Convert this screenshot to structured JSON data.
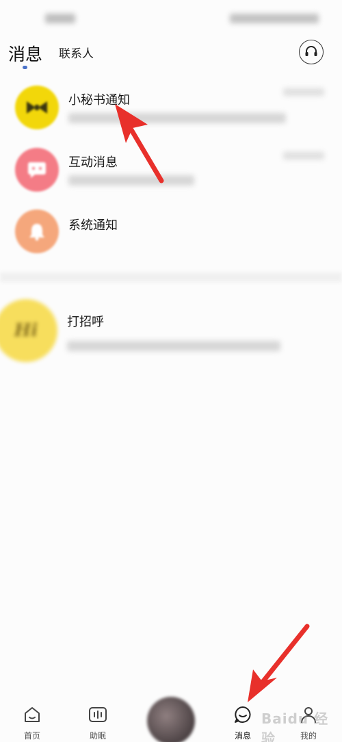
{
  "header": {
    "tabs": [
      {
        "label": "消息",
        "active": true
      },
      {
        "label": "联系人",
        "active": false
      }
    ],
    "support_icon": "headset-icon",
    "accent_color": "#4a72c8"
  },
  "conversations": [
    {
      "title": "小秘书通知",
      "avatar_icon": "bowtie-icon",
      "avatar_color": "#f2d70a"
    },
    {
      "title": "互动消息",
      "avatar_icon": "chat-bubble-icon",
      "avatar_color": "#f47c86"
    },
    {
      "title": "系统通知",
      "avatar_icon": "bell-icon",
      "avatar_color": "#f5a77c"
    }
  ],
  "greeting": {
    "title": "打招呼",
    "avatar_text": "Hi",
    "avatar_color": "#f7de5d"
  },
  "tabbar": {
    "items": [
      {
        "label": "首页",
        "icon": "home-icon"
      },
      {
        "label": "助眠",
        "icon": "sleep-aid-icon"
      },
      {
        "label": "消息",
        "icon": "message-icon",
        "active": true
      },
      {
        "label": "我的",
        "icon": "profile-icon"
      }
    ]
  },
  "annotation": {
    "arrow_color": "#e8302b"
  },
  "watermark": {
    "text": "Baidu 经验"
  }
}
